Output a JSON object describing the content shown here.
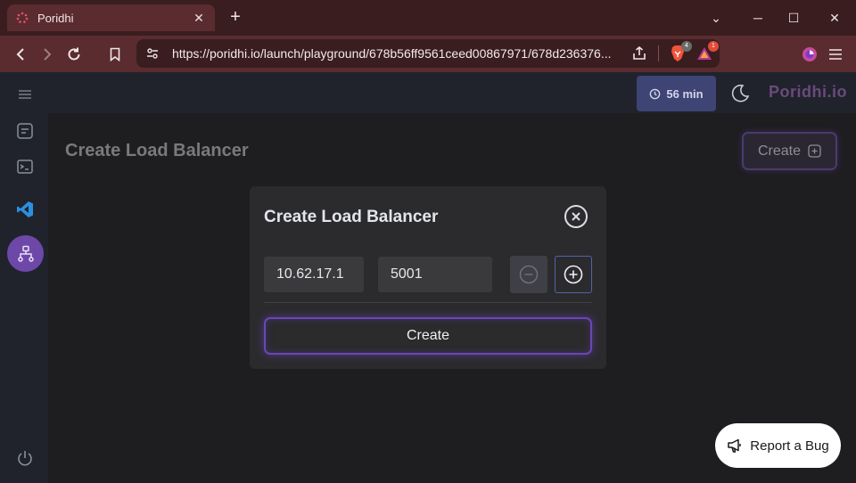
{
  "browser": {
    "tab_title": "Poridhi",
    "url": "https://poridhi.io/launch/playground/678b56ff9561ceed00867971/678d236376...",
    "brave_badge": "4",
    "alert_badge": "1",
    "accent": "#5a2c2f"
  },
  "topbar": {
    "timer": "56 min",
    "logo": "Poridhi.io"
  },
  "page": {
    "title": "Create Load Balancer",
    "create_label": "Create"
  },
  "modal": {
    "title": "Create Load Balancer",
    "ip_value": "10.62.17.1",
    "port_value": "5001",
    "create_label": "Create"
  },
  "report": {
    "label": "Report a Bug"
  },
  "sidebar": {
    "items": [
      "menu-icon",
      "document-icon",
      "terminal-icon",
      "vscode-icon",
      "load-balancer-icon",
      "power-icon"
    ]
  }
}
